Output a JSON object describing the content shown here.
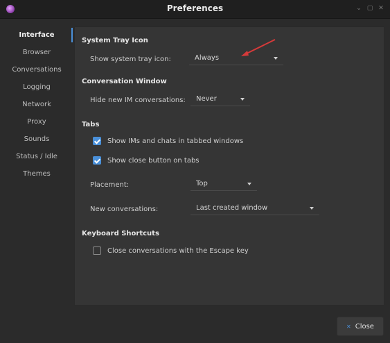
{
  "window": {
    "title": "Preferences",
    "controls": [
      "⌄",
      "▢",
      "✕"
    ]
  },
  "sidebar": {
    "items": [
      {
        "label": "Interface",
        "active": true
      },
      {
        "label": "Browser"
      },
      {
        "label": "Conversations"
      },
      {
        "label": "Logging"
      },
      {
        "label": "Network"
      },
      {
        "label": "Proxy"
      },
      {
        "label": "Sounds"
      },
      {
        "label": "Status / Idle"
      },
      {
        "label": "Themes"
      }
    ]
  },
  "system_tray": {
    "heading": "System Tray Icon",
    "label": "Show system tray icon:",
    "value": "Always"
  },
  "conversation_window": {
    "heading": "Conversation Window",
    "label": "Hide new IM conversations:",
    "value": "Never"
  },
  "tabs": {
    "heading": "Tabs",
    "show_ims_label": "Show IMs and chats in tabbed windows",
    "show_ims_checked": true,
    "show_close_label": "Show close button on tabs",
    "show_close_checked": true,
    "placement_label": "Placement:",
    "placement_value": "Top",
    "new_conv_label": "New conversations:",
    "new_conv_value": "Last created window"
  },
  "keyboard": {
    "heading": "Keyboard Shortcuts",
    "escape_label": "Close conversations with the Escape key",
    "escape_checked": false
  },
  "footer": {
    "close_label": "Close"
  },
  "colors": {
    "accent": "#4a90d9",
    "annotation_arrow": "#d63a3a"
  },
  "icons": {
    "app": "pidgin-app-icon",
    "close": "close-icon"
  }
}
